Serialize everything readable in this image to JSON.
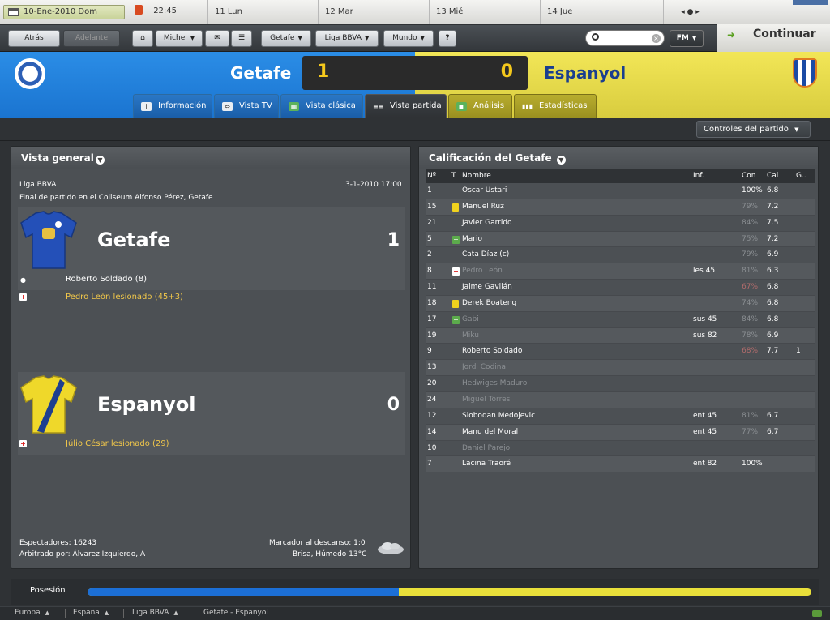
{
  "calendar": {
    "date": "10-Ene-2010 Dom",
    "time": "22:45",
    "days": [
      "11 Lun",
      "12 Mar",
      "13 Mié",
      "14 Jue"
    ],
    "nav_arrows": "◂ ● ▸"
  },
  "toolbar": {
    "back": "Atrás",
    "forward": "Adelante",
    "home_icon": "home-icon",
    "manager": "Michel",
    "club": "Getafe",
    "league": "Liga BBVA",
    "world": "Mundo",
    "help": "?",
    "search_placeholder": "",
    "fm_button": "FM",
    "continue": "Continuar"
  },
  "match": {
    "home_team": "Getafe",
    "away_team": "Espanyol",
    "home_score": "1",
    "away_score": "0",
    "colors": {
      "home": "#2186e0",
      "away": "#e8dc48",
      "score": "#f4c81c"
    }
  },
  "tabs": [
    {
      "label": "Información",
      "icon": "info-icon",
      "active": false
    },
    {
      "label": "Vista TV",
      "icon": "tv-icon",
      "active": false
    },
    {
      "label": "Vista clásica",
      "icon": "pitch-icon",
      "active": false
    },
    {
      "label": "Vista partida",
      "icon": "split-view-icon",
      "active": true
    },
    {
      "label": "Análisis",
      "icon": "analysis-icon",
      "active": false
    },
    {
      "label": "Estadísticas",
      "icon": "stats-icon",
      "active": false
    }
  ],
  "controls_button": "Controles del partido",
  "overview": {
    "title": "Vista general",
    "competition": "Liga BBVA",
    "datetime": "3-1-2010 17:00",
    "venue": "Final de partido en el Coliseum Alfonso Pérez, Getafe",
    "home": {
      "name": "Getafe",
      "goals": "1",
      "events": [
        {
          "icon": "ball-icon",
          "text": "Roberto Soldado (8)",
          "kind": "goal"
        },
        {
          "icon": "injury-icon",
          "text": "Pedro León lesionado (45+3)",
          "kind": "injury"
        }
      ]
    },
    "away": {
      "name": "Espanyol",
      "goals": "0",
      "events": [
        {
          "icon": "injury-icon",
          "text": "Júlio César lesionado (29)",
          "kind": "injury"
        }
      ]
    },
    "spectators": "Espectadores: 16243",
    "referee": "Arbitrado por: Álvarez Izquierdo, A",
    "halftime": "Marcador al descanso: 1:0",
    "weather": "Brisa, Húmedo 13°C"
  },
  "ratings": {
    "title": "Calificación del Getafe",
    "headers": {
      "num": "Nº",
      "t": "T",
      "name": "Nombre",
      "inf": "Inf.",
      "con": "Con",
      "cal": "Cal",
      "g": "G.."
    },
    "rows": [
      {
        "num": "1",
        "mark": "",
        "name": "Oscar Ustari",
        "inf": "",
        "con": "100%",
        "con_style": "",
        "cal": "6.8",
        "g": "",
        "dim": false
      },
      {
        "num": "15",
        "mark": "yellow",
        "name": "Manuel Ruz",
        "inf": "",
        "con": "79%",
        "con_style": "dim",
        "cal": "7.2",
        "g": "",
        "dim": false
      },
      {
        "num": "21",
        "mark": "",
        "name": "Javier Garrido",
        "inf": "",
        "con": "84%",
        "con_style": "dim",
        "cal": "7.5",
        "g": "",
        "dim": false
      },
      {
        "num": "5",
        "mark": "sub",
        "name": "Mario",
        "inf": "",
        "con": "75%",
        "con_style": "dim",
        "cal": "7.2",
        "g": "",
        "dim": false
      },
      {
        "num": "2",
        "mark": "",
        "name": "Cata Díaz (c)",
        "inf": "",
        "con": "79%",
        "con_style": "dim",
        "cal": "6.9",
        "g": "",
        "dim": false
      },
      {
        "num": "8",
        "mark": "injury",
        "name": "Pedro León",
        "inf": "les 45",
        "con": "81%",
        "con_style": "dim",
        "cal": "6.3",
        "g": "",
        "dim": true
      },
      {
        "num": "11",
        "mark": "",
        "name": "Jaime Gavilán",
        "inf": "",
        "con": "67%",
        "con_style": "red",
        "cal": "6.8",
        "g": "",
        "dim": false
      },
      {
        "num": "18",
        "mark": "yellow",
        "name": "Derek Boateng",
        "inf": "",
        "con": "74%",
        "con_style": "dim",
        "cal": "6.8",
        "g": "",
        "dim": false
      },
      {
        "num": "17",
        "mark": "sub",
        "name": "Gabi",
        "inf": "sus 45",
        "con": "84%",
        "con_style": "dim",
        "cal": "6.8",
        "g": "",
        "dim": true
      },
      {
        "num": "19",
        "mark": "",
        "name": "Miku",
        "inf": "sus 82",
        "con": "78%",
        "con_style": "dim",
        "cal": "6.9",
        "g": "",
        "dim": true
      },
      {
        "num": "9",
        "mark": "",
        "name": "Roberto Soldado",
        "inf": "",
        "con": "68%",
        "con_style": "red",
        "cal": "7.7",
        "g": "1",
        "dim": false
      },
      {
        "num": "13",
        "mark": "",
        "name": "Jordi Codina",
        "inf": "",
        "con": "",
        "con_style": "",
        "cal": "",
        "g": "",
        "dim": true
      },
      {
        "num": "20",
        "mark": "",
        "name": "Hedwiges Maduro",
        "inf": "",
        "con": "",
        "con_style": "",
        "cal": "",
        "g": "",
        "dim": true
      },
      {
        "num": "24",
        "mark": "",
        "name": "Miguel Torres",
        "inf": "",
        "con": "",
        "con_style": "",
        "cal": "",
        "g": "",
        "dim": true
      },
      {
        "num": "12",
        "mark": "",
        "name": "Slobodan Medojevic",
        "inf": "ent 45",
        "con": "81%",
        "con_style": "dim",
        "cal": "6.7",
        "g": "",
        "dim": false
      },
      {
        "num": "14",
        "mark": "",
        "name": "Manu del Moral",
        "inf": "ent 45",
        "con": "77%",
        "con_style": "dim",
        "cal": "6.7",
        "g": "",
        "dim": false
      },
      {
        "num": "10",
        "mark": "",
        "name": "Daniel Parejo",
        "inf": "",
        "con": "",
        "con_style": "",
        "cal": "",
        "g": "",
        "dim": true
      },
      {
        "num": "7",
        "mark": "",
        "name": "Lacina Traoré",
        "inf": "ent 82",
        "con": "100%",
        "con_style": "",
        "cal": "",
        "g": "",
        "dim": false
      }
    ]
  },
  "possession": {
    "label": "Posesión",
    "home_fraction": 0.43
  },
  "breadcrumbs": [
    "Europa",
    "España",
    "Liga BBVA",
    "Getafe - Espanyol"
  ]
}
